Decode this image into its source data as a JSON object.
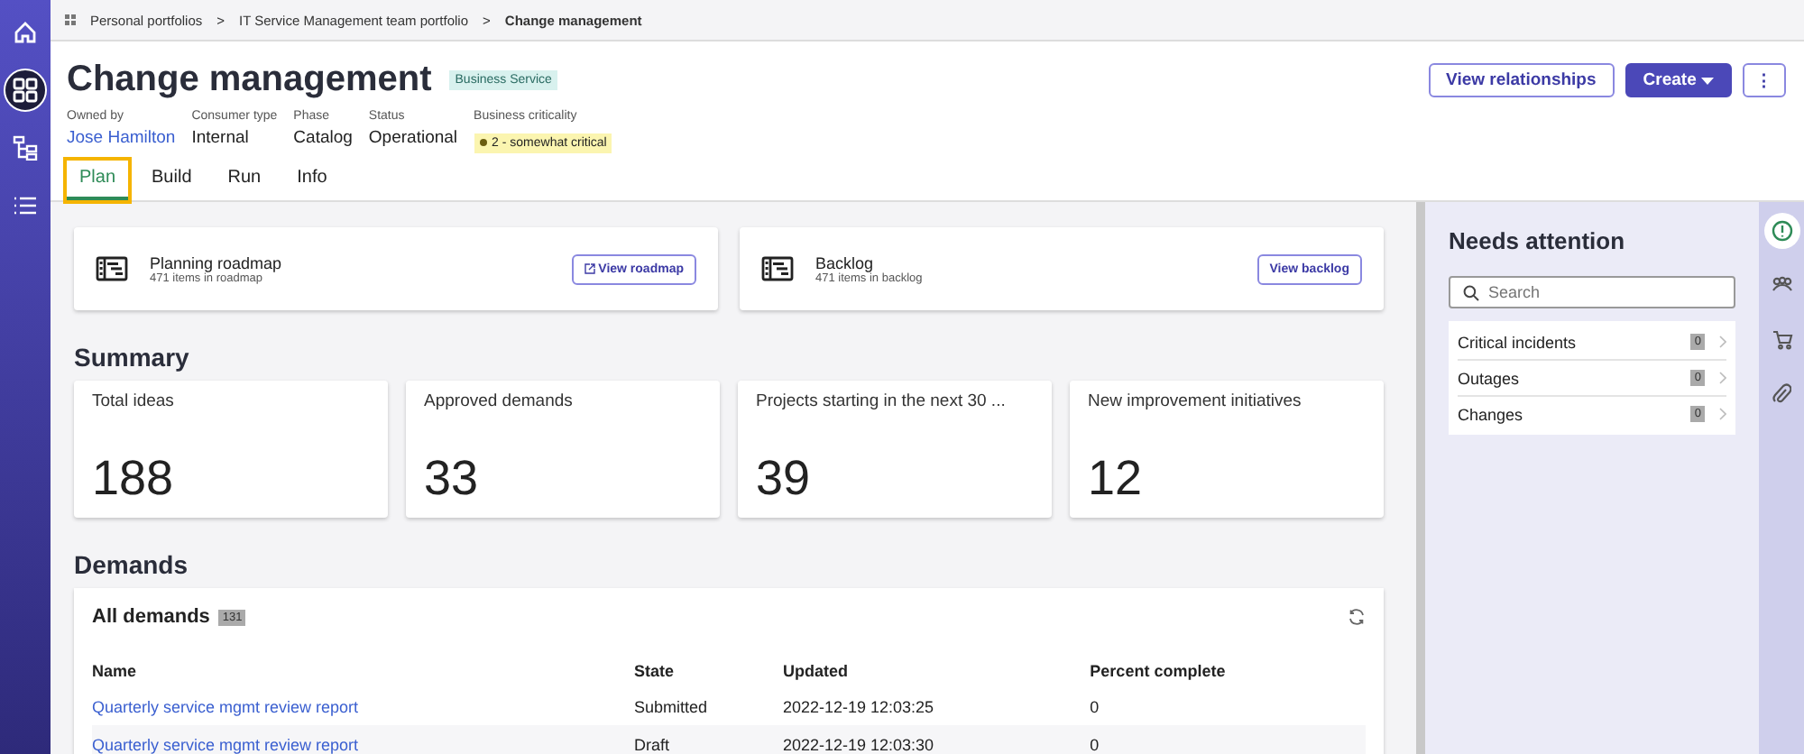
{
  "nav": [
    {
      "kind": "home",
      "selected": false
    },
    {
      "kind": "apps",
      "selected": true
    },
    {
      "kind": "tree",
      "selected": false
    },
    {
      "kind": "list",
      "selected": false
    }
  ],
  "breadcrumbs": [
    {
      "label": "Personal portfolios",
      "current": false
    },
    {
      "label": "IT Service Management team portfolio",
      "current": false
    },
    {
      "label": "Change management",
      "current": true
    }
  ],
  "breadcrumb_separator": ">",
  "title": "Change management",
  "tag": "Business Service",
  "fields": [
    {
      "label": "Owned by",
      "value": "Jose Hamilton",
      "kind": "link"
    },
    {
      "label": "Consumer type",
      "value": "Internal",
      "kind": "text"
    },
    {
      "label": "Phase",
      "value": "Catalog",
      "kind": "text"
    },
    {
      "label": "Status",
      "value": "Operational",
      "kind": "text"
    },
    {
      "label": "Business criticality",
      "value": "2 - somewhat critical",
      "kind": "badge"
    }
  ],
  "tabs": [
    {
      "label": "Plan",
      "selected": true
    },
    {
      "label": "Build",
      "selected": false
    },
    {
      "label": "Run",
      "selected": false
    },
    {
      "label": "Info",
      "selected": false
    }
  ],
  "actions": [
    {
      "label": "View relationships",
      "kind": "secondary"
    },
    {
      "label": "Create",
      "kind": "primary"
    },
    {
      "label": "⋮",
      "kind": "more"
    }
  ],
  "cards": [
    {
      "title": "Planning roadmap",
      "subtitle": "471 items in roadmap",
      "button": "View roadmap",
      "external": true
    },
    {
      "title": "Backlog",
      "subtitle": "471 items in backlog",
      "button": "View backlog",
      "external": false
    }
  ],
  "summary": {
    "heading": "Summary",
    "stats": [
      {
        "label": "Total ideas",
        "value": "188"
      },
      {
        "label": "Approved demands",
        "value": "33"
      },
      {
        "label": "Projects starting in the next 30 ...",
        "value": "39"
      },
      {
        "label": "New improvement initiatives",
        "value": "12"
      }
    ]
  },
  "demands": {
    "heading": "Demands",
    "title": "All demands",
    "count": "131",
    "columns": [
      "Name",
      "State",
      "Updated",
      "Percent complete"
    ],
    "rows": [
      [
        "Quarterly service mgmt review report",
        "Submitted",
        "2022-12-19 12:03:25",
        "0"
      ],
      [
        "Quarterly service mgmt review report",
        "Draft",
        "2022-12-19 12:03:30",
        "0"
      ]
    ]
  },
  "attention": {
    "title": "Needs attention",
    "search": {
      "placeholder": "Search"
    },
    "items": [
      {
        "label": "Critical incidents",
        "count": "0"
      },
      {
        "label": "Outages",
        "count": "0"
      },
      {
        "label": "Changes",
        "count": "0"
      }
    ]
  },
  "rail": [
    {
      "kind": "alert",
      "selected": true
    },
    {
      "kind": "people",
      "selected": false
    },
    {
      "kind": "cart",
      "selected": false
    },
    {
      "kind": "clip",
      "selected": false
    }
  ]
}
